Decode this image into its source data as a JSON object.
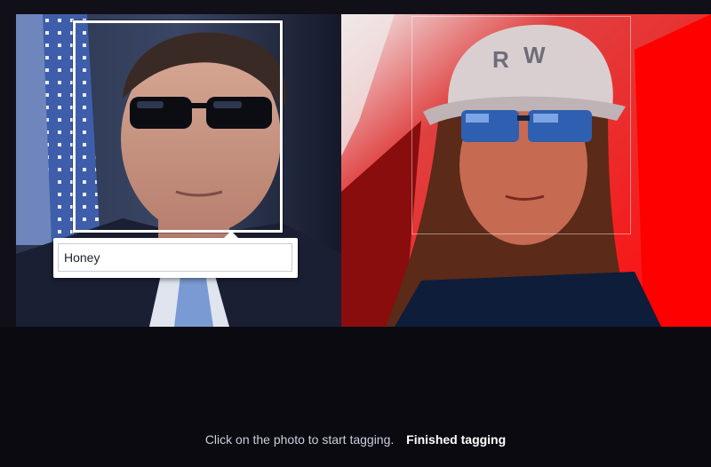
{
  "tagging": {
    "input_value": "Honey",
    "hint_text": "Click on the photo to start tagging.",
    "finish_label": "Finished tagging"
  },
  "colors": {
    "background": "#0b0a10",
    "right_photo_red": "#d61010",
    "active_box": "#ffffff",
    "hint_text": "#c8cfe0"
  },
  "icons": {
    "tag_popup_pointer": "caret-up-icon"
  }
}
